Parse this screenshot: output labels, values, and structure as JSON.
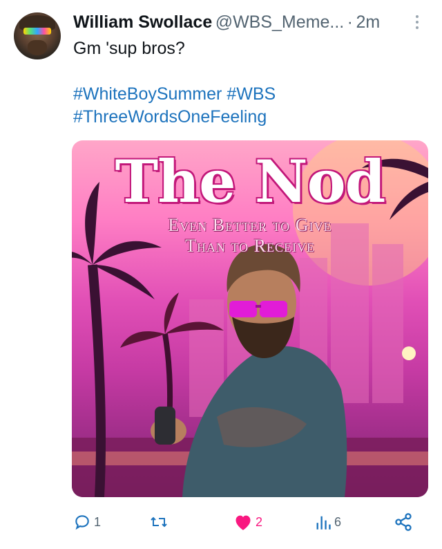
{
  "tweet": {
    "display_name": "William Swollace",
    "handle": "@WBS_Meme...",
    "separator": "·",
    "time": "2m",
    "text": "Gm 'sup bros?",
    "hashtags": [
      "#WhiteBoySummer",
      "#WBS",
      "#ThreeWordsOneFeeling"
    ]
  },
  "media": {
    "title": "The Nod",
    "subtitle_line1": "Even Better to Give",
    "subtitle_line2": "Than to Receive"
  },
  "actions": {
    "reply_count": "1",
    "retweet_count": "",
    "like_count": "2",
    "views_count": "6"
  },
  "colors": {
    "link": "#1d73bd",
    "like": "#f91880",
    "muted": "#536471"
  },
  "icons": [
    "more-icon",
    "reply-icon",
    "retweet-icon",
    "heart-icon",
    "views-icon",
    "share-icon"
  ]
}
